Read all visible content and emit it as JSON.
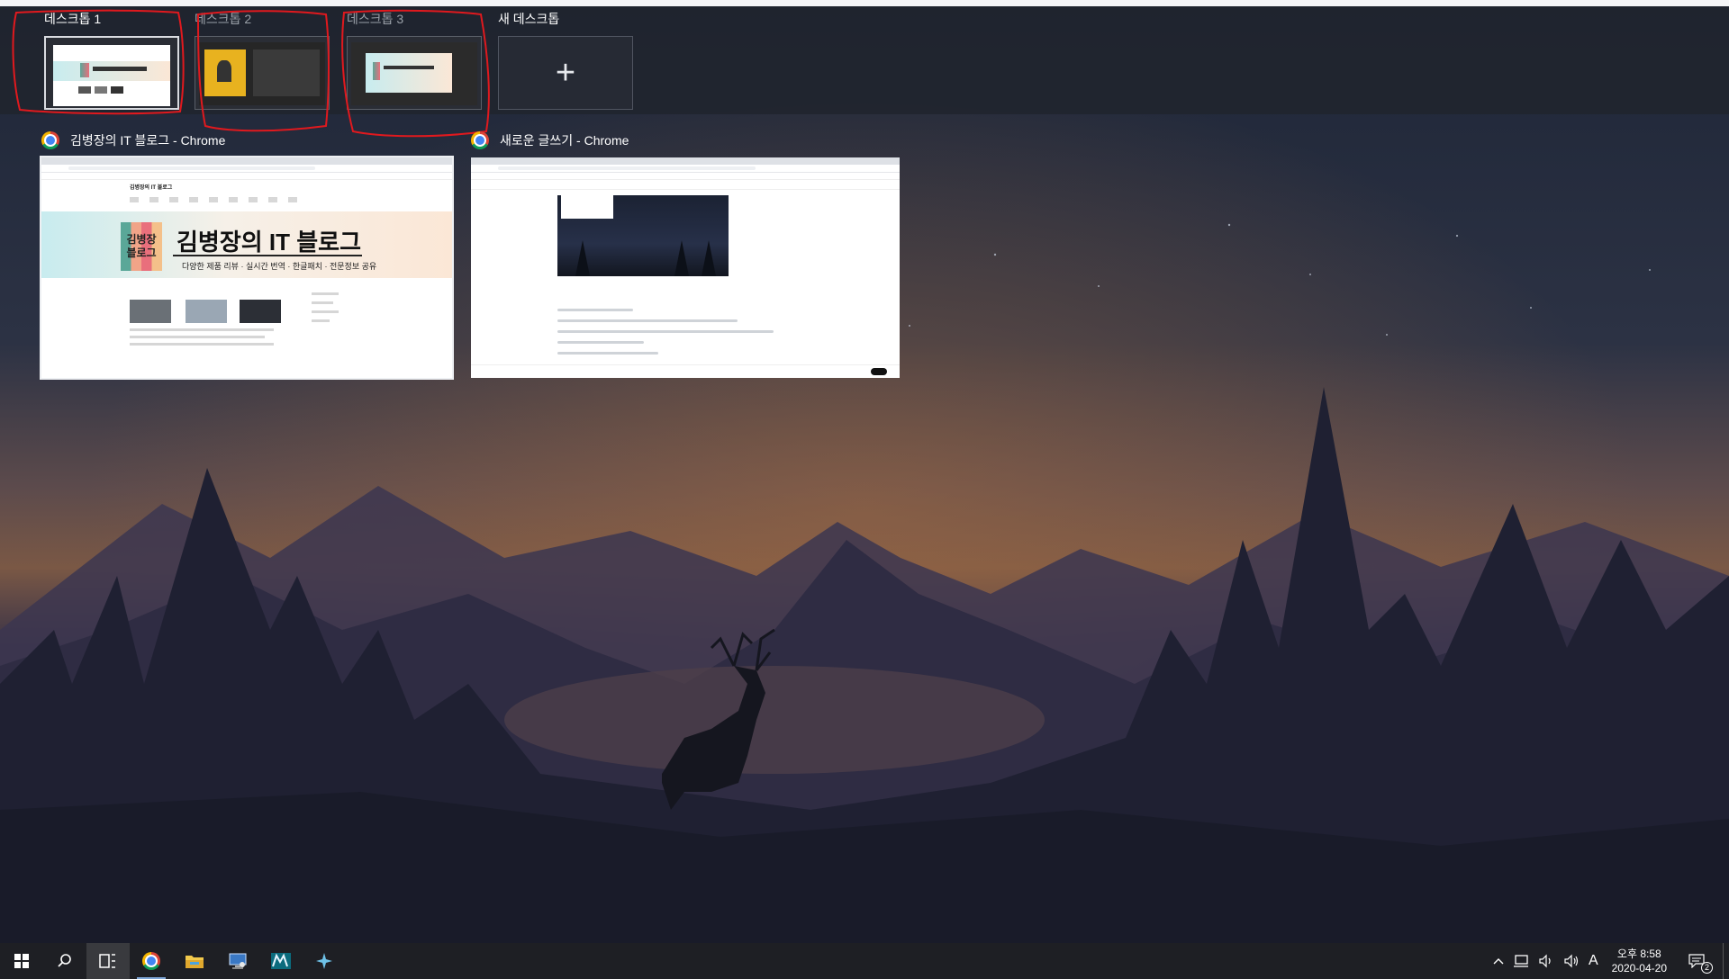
{
  "virtual_desktops": [
    {
      "label": "데스크톱 1",
      "active": true
    },
    {
      "label": "데스크톱 2",
      "active": false
    },
    {
      "label": "데스크톱 3",
      "active": false
    }
  ],
  "new_desktop": {
    "label": "새 데스크톱",
    "icon": "plus-icon"
  },
  "windows": [
    {
      "title": "김병장의 IT 블로그 - Chrome",
      "app_icon": "chrome-icon",
      "content": {
        "blog_name": "김병장의 IT 블로그",
        "logo_line1": "김병장",
        "logo_line2": "블로그",
        "banner_title": "김병장의 IT 블로그",
        "banner_subtitle": "다양한 제품 리뷰 · 실시간 번역 · 한글패치 · 전문정보 공유"
      }
    },
    {
      "title": "새로운 글쓰기 - Chrome",
      "app_icon": "chrome-icon"
    }
  ],
  "taskbar": {
    "start": "windows-start-icon",
    "pinned": [
      "search-icon",
      "task-view-icon",
      "chrome-icon",
      "file-explorer-icon",
      "remote-desktop-icon",
      "3dsmax-icon",
      "app-icon"
    ],
    "tray": {
      "ime": "A",
      "time": "오후 8:58",
      "date": "2020-04-20",
      "notifications": "2"
    }
  },
  "colors": {
    "annotation": "#e0191e",
    "taskbar": "#1e1f24",
    "accent": "#7fa7d8"
  }
}
